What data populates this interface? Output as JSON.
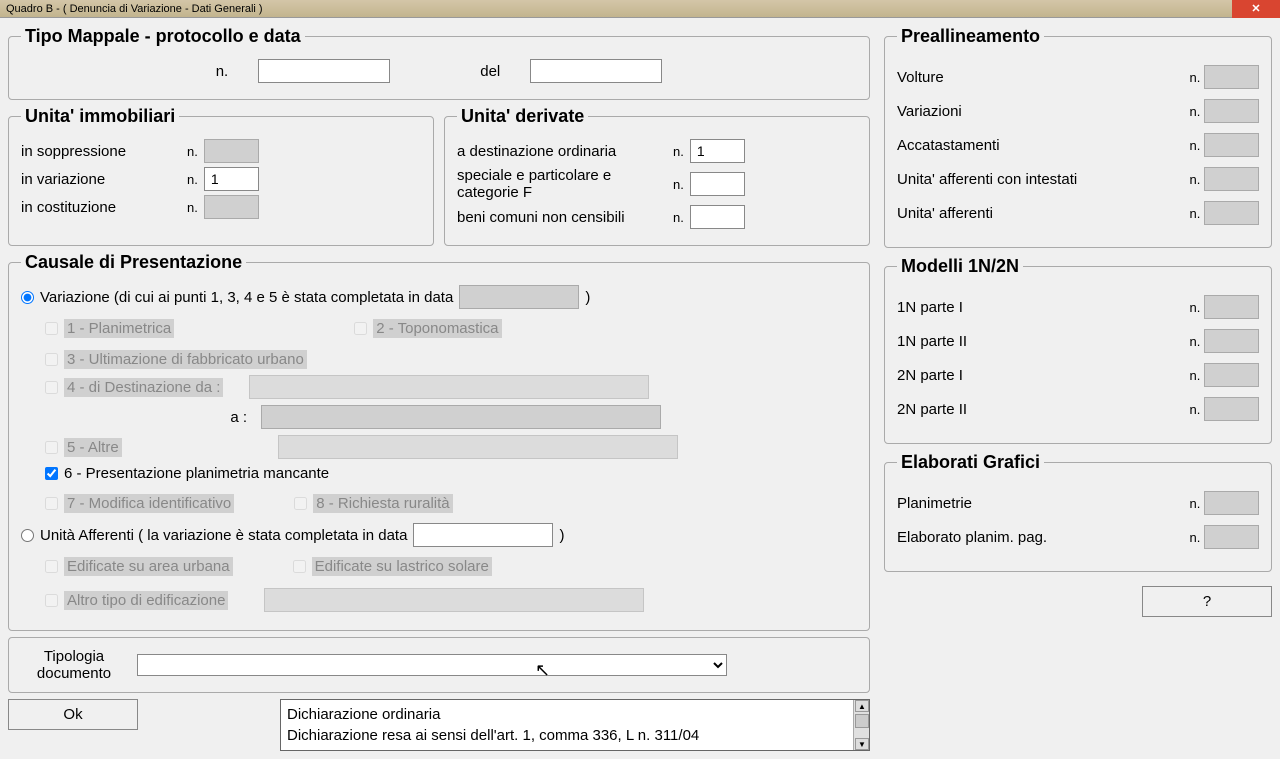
{
  "window": {
    "title": "Quadro B - ( Denuncia di Variazione - Dati Generali )"
  },
  "tipoMappale": {
    "legend": "Tipo Mappale - protocollo e data",
    "n_label": "n.",
    "del_label": "del",
    "n_value": "",
    "del_value": ""
  },
  "unitaImmobiliari": {
    "legend": "Unita' immobiliari",
    "rows": [
      {
        "label": "in soppressione",
        "nlabel": "n.",
        "value": "",
        "readonly": true
      },
      {
        "label": "in variazione",
        "nlabel": "n.",
        "value": "1",
        "readonly": false
      },
      {
        "label": "in costituzione",
        "nlabel": "n.",
        "value": "",
        "readonly": true
      }
    ]
  },
  "unitaDerivate": {
    "legend": "Unita' derivate",
    "rows": [
      {
        "label": "a destinazione ordinaria",
        "nlabel": "n.",
        "value": "1"
      },
      {
        "label": "speciale e particolare e categorie F",
        "nlabel": "n.",
        "value": ""
      },
      {
        "label": "beni comuni non censibili",
        "nlabel": "n.",
        "value": ""
      }
    ]
  },
  "causale": {
    "legend": "Causale di Presentazione",
    "variazione_label": "Variazione (di cui ai punti 1, 3, 4 e 5 è stata completata in data",
    "variazione_close": ")",
    "unita_afferenti_label": "Unità Afferenti ( la variazione è stata completata in data",
    "unita_afferenti_close": ")",
    "opts": {
      "c1": "1 - Planimetrica",
      "c2": "2 - Toponomastica",
      "c3": "3 - Ultimazione di fabbricato urbano",
      "c4": "4 - di Destinazione da :",
      "c4a": "a :",
      "c5": "5 - Altre",
      "c6": "6 - Presentazione planimetria mancante",
      "c7": "7 - Modifica identificativo",
      "c8": "8 - Richiesta ruralità",
      "ua1": "Edificate su area urbana",
      "ua2": "Edificate su lastrico solare",
      "ua3": "Altro tipo di edificazione"
    }
  },
  "tipologia": {
    "label": "Tipologia documento",
    "options": [
      "",
      "Dichiarazione ordinaria",
      "Dichiarazione resa ai sensi dell'art. 1, comma 336, L n. 311/04"
    ]
  },
  "buttons": {
    "ok": "Ok",
    "help": "?"
  },
  "preallineamento": {
    "legend": "Preallineamento",
    "rows": [
      {
        "label": "Volture",
        "nlabel": "n."
      },
      {
        "label": "Variazioni",
        "nlabel": "n."
      },
      {
        "label": "Accatastamenti",
        "nlabel": "n."
      },
      {
        "label": "Unita' afferenti con intestati",
        "nlabel": "n."
      },
      {
        "label": "Unita' afferenti",
        "nlabel": "n."
      }
    ]
  },
  "modelli": {
    "legend": "Modelli 1N/2N",
    "rows": [
      {
        "label": "1N parte I",
        "nlabel": "n."
      },
      {
        "label": "1N parte II",
        "nlabel": "n."
      },
      {
        "label": "2N parte I",
        "nlabel": "n."
      },
      {
        "label": "2N parte II",
        "nlabel": "n."
      }
    ]
  },
  "elaborati": {
    "legend": "Elaborati Grafici",
    "rows": [
      {
        "label": "Planimetrie",
        "nlabel": "n."
      },
      {
        "label": "Elaborato planim. pag.",
        "nlabel": "n."
      }
    ]
  }
}
